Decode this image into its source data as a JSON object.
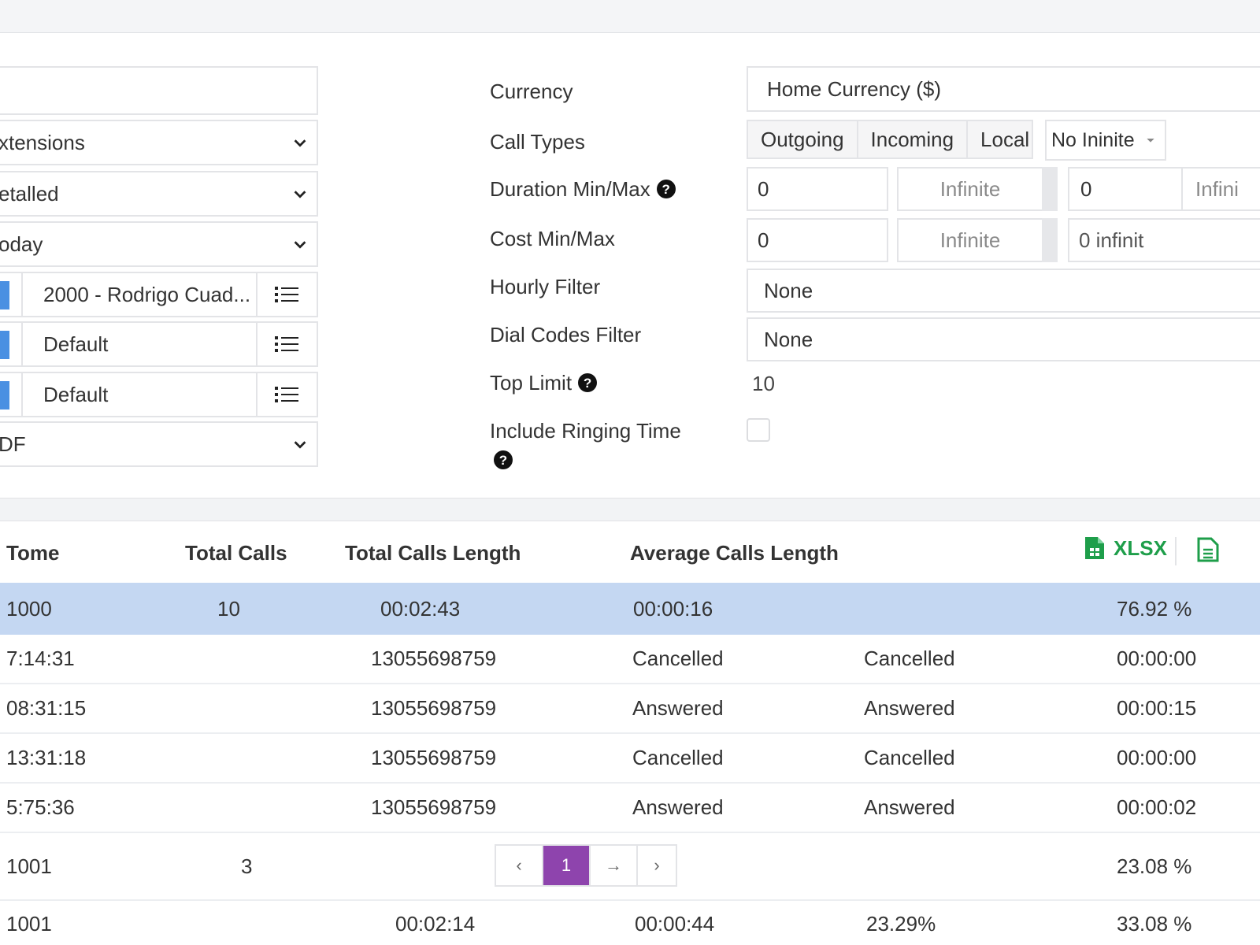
{
  "left_filters": {
    "extensions_select": "xtensions",
    "detail_select": "etalled",
    "period_select": "oday",
    "pick_rows": [
      {
        "label": "2000 - Rodrigo Cuad..."
      },
      {
        "label": "Default"
      },
      {
        "label": "Default"
      }
    ],
    "format_select": "DF"
  },
  "right_filters": {
    "currency": {
      "label": "Currency",
      "value": "Home Currency ($)"
    },
    "call_types": {
      "label": "Call Types",
      "options": [
        "Outgoing",
        "Incoming",
        "Local"
      ],
      "no_infinite": "No Ininite"
    },
    "duration": {
      "label": "Duration Min/Max",
      "min": "0",
      "max_placeholder": "Infinite",
      "min2": "0",
      "max2_placeholder": "Infini"
    },
    "cost": {
      "label": "Cost Min/Max",
      "min": "0",
      "max_placeholder": "Infinite",
      "extra": "0 infinit"
    },
    "hourly": {
      "label": "Hourly Filter",
      "value": "None"
    },
    "dial_codes": {
      "label": "Dial Codes Filter",
      "value": "None"
    },
    "top_limit": {
      "label": "Top Limit",
      "value": "10"
    },
    "ringing": {
      "label": "Include Ringing Time",
      "checked": false
    }
  },
  "table": {
    "headers": [
      "Tome",
      "Total Calls",
      "Total Calls Length",
      "Average Calls Length"
    ],
    "export_label": "XLSX",
    "rows": [
      {
        "c1": "1000",
        "c2": "10",
        "c3": "00:02:43",
        "c4": "00:00:16",
        "c5": "",
        "c6": "76.92 %",
        "highlight": true
      },
      {
        "c1": "7:14:31",
        "c2": "",
        "c3": "13055698759",
        "c4": "Cancelled",
        "c5": "Cancelled",
        "c6": "00:00:00"
      },
      {
        "c1": "08:31:15",
        "c2": "",
        "c3": "13055698759",
        "c4": "Answered",
        "c5": "Answered",
        "c6": "00:00:15"
      },
      {
        "c1": "13:31:18",
        "c2": "",
        "c3": "13055698759",
        "c4": "Cancelled",
        "c5": "Cancelled",
        "c6": "00:00:00"
      },
      {
        "c1": "5:75:36",
        "c2": "",
        "c3": "13055698759",
        "c4": "Answered",
        "c5": "Answered",
        "c6": "00:00:02"
      },
      {
        "c1": "1001",
        "c2": "3",
        "c3": "",
        "c4": "",
        "c5": "",
        "c6": "23.08 %"
      },
      {
        "c1": "1001",
        "c2": "",
        "c3": "00:02:14",
        "c4": "00:00:44",
        "c5": "23.29%",
        "c6": "33.08 %"
      }
    ]
  },
  "pagination": {
    "prev": "‹",
    "current": "1",
    "next_arrow": "→",
    "next": "›"
  },
  "colors": {
    "highlight_row": "#c4d7f2",
    "pagination_active": "#8e44ad",
    "export_green": "#1e9e4a",
    "accent_blue": "#4a90e2"
  }
}
